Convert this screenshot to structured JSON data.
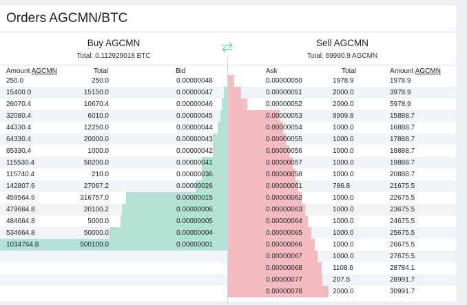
{
  "title": "Orders AGCMN/BTC",
  "buy": {
    "heading": "Buy AGCMN",
    "total": "Total: 0.112929018 BTC",
    "col_amount_prefix": "Amount ",
    "col_amount_link": "AGCMN",
    "col_total": "Total",
    "col_bid": "Bid",
    "max_depth": 1034764.8,
    "rows": [
      {
        "amount": "250.0",
        "total": "250.0",
        "price": "0.00000048"
      },
      {
        "amount": "15400.0",
        "total": "15150.0",
        "price": "0.00000047"
      },
      {
        "amount": "26070.4",
        "total": "10670.4",
        "price": "0.00000046"
      },
      {
        "amount": "32080.4",
        "total": "6010.0",
        "price": "0.00000045"
      },
      {
        "amount": "44330.4",
        "total": "12250.0",
        "price": "0.00000044"
      },
      {
        "amount": "64330.4",
        "total": "20000.0",
        "price": "0.00000043"
      },
      {
        "amount": "65330.4",
        "total": "1000.0",
        "price": "0.00000042"
      },
      {
        "amount": "115530.4",
        "total": "50200.0",
        "price": "0.00000041"
      },
      {
        "amount": "115740.4",
        "total": "210.0",
        "price": "0.00000036"
      },
      {
        "amount": "142807.6",
        "total": "27067.2",
        "price": "0.00000026"
      },
      {
        "amount": "459564.6",
        "total": "316757.0",
        "price": "0.00000015"
      },
      {
        "amount": "479664.8",
        "total": "20100.2",
        "price": "0.00000006"
      },
      {
        "amount": "484664.8",
        "total": "5000.0",
        "price": "0.00000005"
      },
      {
        "amount": "534664.8",
        "total": "50000.0",
        "price": "0.00000004"
      },
      {
        "amount": "1034764.8",
        "total": "500100.0",
        "price": "0.00000001"
      }
    ]
  },
  "sell": {
    "heading": "Sell AGCMN",
    "total": "Total: 69990.9 AGCMN",
    "col_ask": "Ask",
    "col_total": "Total",
    "col_amount_prefix": "Amount ",
    "col_amount_link": "AGCMN",
    "max_depth": 69990.9,
    "rows": [
      {
        "price": "0.00000050",
        "total": "1978.9",
        "amount": "1978.9"
      },
      {
        "price": "0.00000051",
        "total": "2000.0",
        "amount": "3978.9"
      },
      {
        "price": "0.00000052",
        "total": "2000.0",
        "amount": "5978.9"
      },
      {
        "price": "0.00000053",
        "total": "9909.8",
        "amount": "15888.7"
      },
      {
        "price": "0.00000054",
        "total": "1000.0",
        "amount": "16888.7"
      },
      {
        "price": "0.00000055",
        "total": "1000.0",
        "amount": "17888.7"
      },
      {
        "price": "0.00000056",
        "total": "1000.0",
        "amount": "18888.7"
      },
      {
        "price": "0.00000057",
        "total": "1000.0",
        "amount": "19888.7"
      },
      {
        "price": "0.00000058",
        "total": "1000.0",
        "amount": "20888.7"
      },
      {
        "price": "0.00000061",
        "total": "786.8",
        "amount": "21675.5"
      },
      {
        "price": "0.00000062",
        "total": "1000.0",
        "amount": "22675.5"
      },
      {
        "price": "0.00000063",
        "total": "1000.0",
        "amount": "23675.5"
      },
      {
        "price": "0.00000064",
        "total": "1000.0",
        "amount": "24675.5"
      },
      {
        "price": "0.00000065",
        "total": "1000.0",
        "amount": "25675.5"
      },
      {
        "price": "0.00000066",
        "total": "1000.0",
        "amount": "26675.5"
      },
      {
        "price": "0.00000067",
        "total": "1000.0",
        "amount": "27675.5"
      },
      {
        "price": "0.00000068",
        "total": "1108.6",
        "amount": "28784.1"
      },
      {
        "price": "0.00000077",
        "total": "207.5",
        "amount": "28991.7"
      },
      {
        "price": "0.00000078",
        "total": "2000.0",
        "amount": "30991.7"
      }
    ]
  },
  "colors": {
    "buy_bar": "#b3e2d4",
    "sell_bar": "#f4bcc0",
    "swap_icon": "#7fcfc3"
  },
  "icons": {
    "swap": "swap-arrows-icon"
  }
}
